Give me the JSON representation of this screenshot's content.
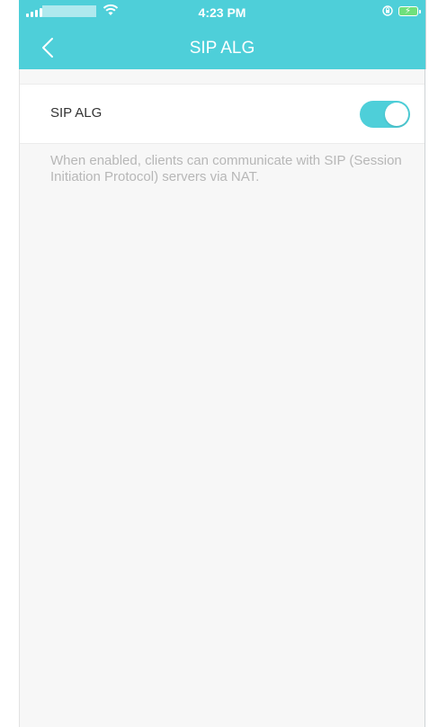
{
  "status_bar": {
    "time": "4:23 PM",
    "icons": [
      "signal-icon",
      "wifi-icon",
      "rotation-lock-icon",
      "battery-charging-icon"
    ]
  },
  "nav": {
    "title": "SIP ALG",
    "back_icon": "chevron-left-icon"
  },
  "setting": {
    "label": "SIP ALG",
    "enabled": true
  },
  "description": "When enabled, clients can communicate with SIP (Session Initiation Protocol) servers via NAT.",
  "colors": {
    "accent": "#4ecfd9",
    "background": "#f7f7f7",
    "description_text": "#b7b7b7",
    "label_text": "#333333"
  }
}
